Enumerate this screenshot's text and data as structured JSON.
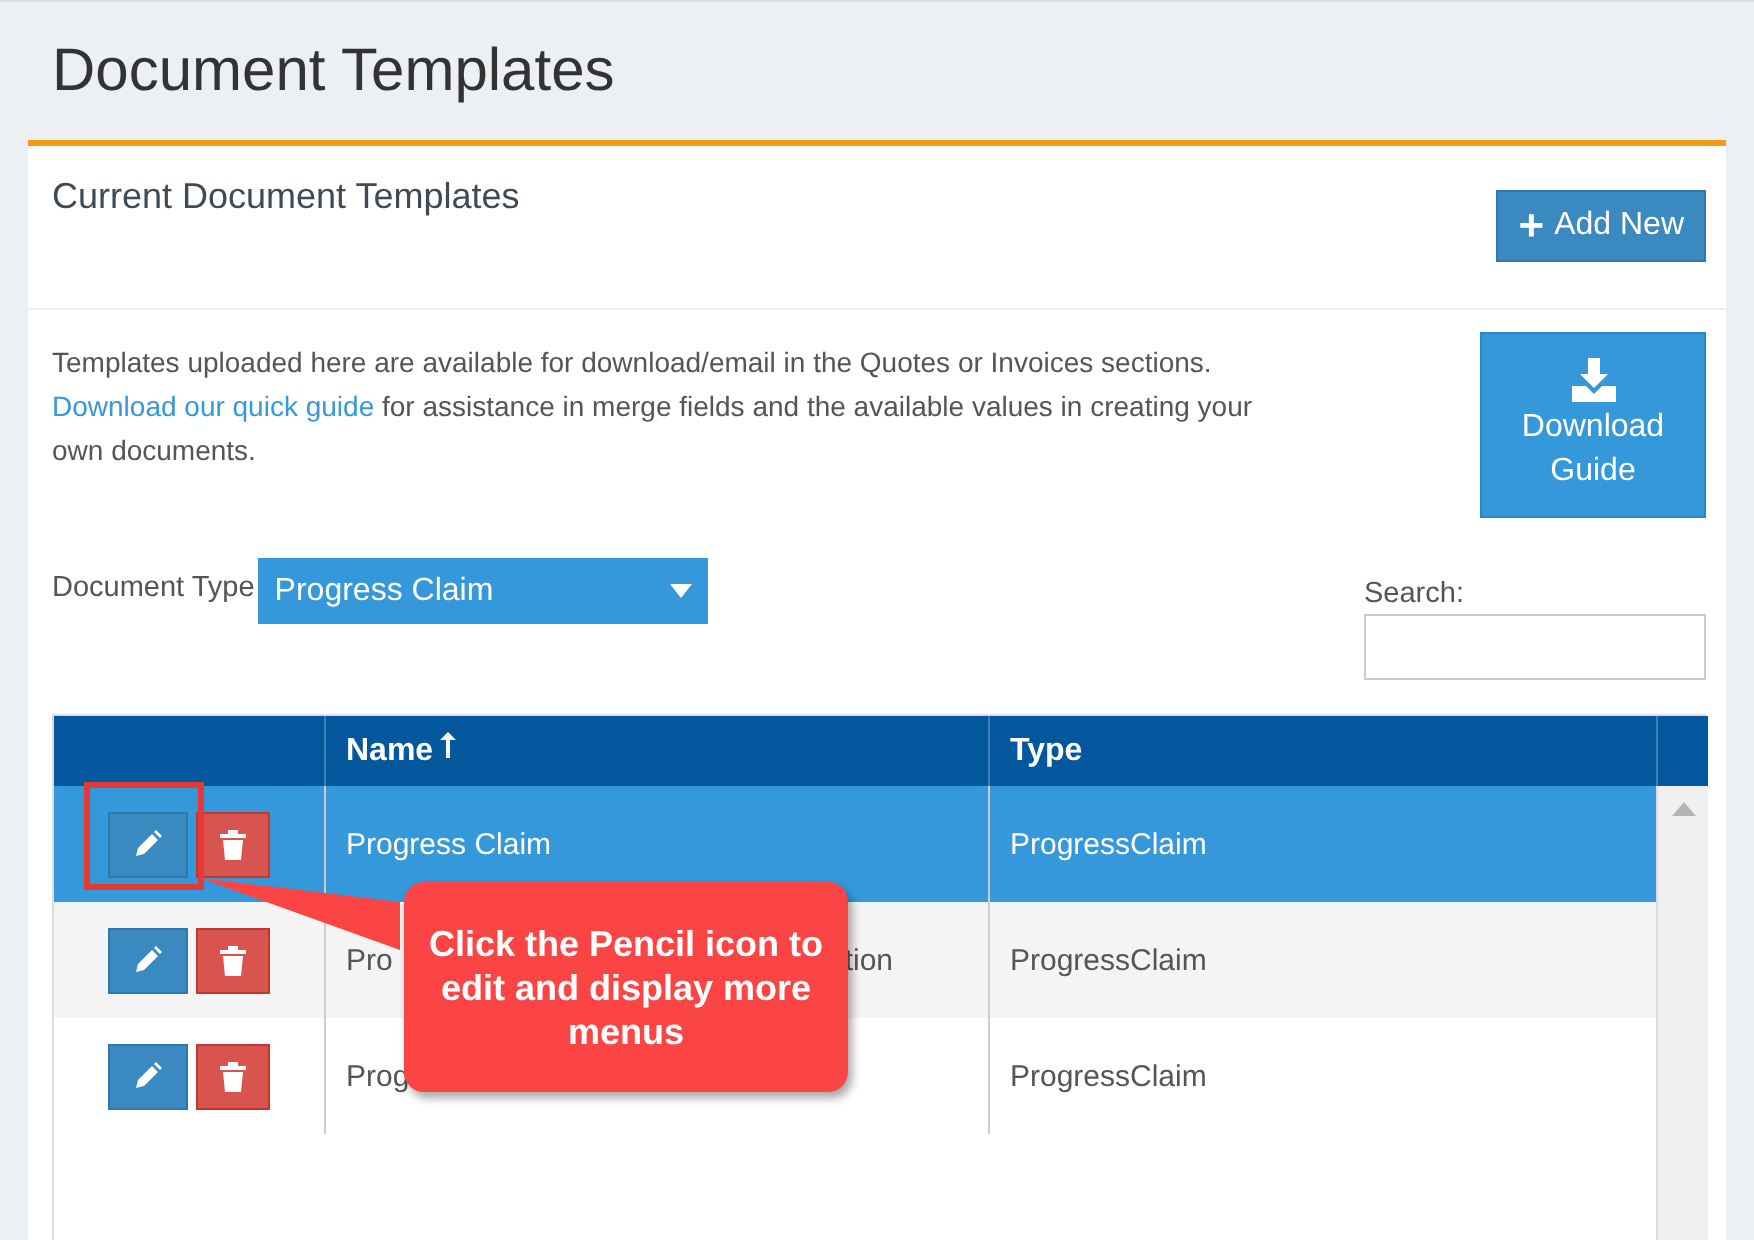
{
  "page_title": "Document Templates",
  "panel": {
    "title": "Current Document Templates",
    "add_button": {
      "icon": "+",
      "label": "Add New"
    }
  },
  "intro": {
    "text": "Templates uploaded here are available for download/email in the Quotes or Invoices sections.",
    "link": "Download our quick guide",
    "text_after": " for assistance in merge fields and the available values in creating your own documents."
  },
  "download_button": {
    "label": "Download Guide"
  },
  "filter": {
    "label": "Document Type",
    "value": "Progress Claim"
  },
  "search": {
    "label": "Search:"
  },
  "table": {
    "columns": [
      {
        "label": "Name",
        "sorted": true
      },
      {
        "label": "Type",
        "sorted": false
      }
    ],
    "rows": [
      {
        "selected": true,
        "highlighted": true,
        "name_parts": [
          "Progress Claim"
        ],
        "type": "ProgressClaim"
      },
      {
        "selected": false,
        "highlighted": false,
        "name_parts": [
          "Pro",
          "tion"
        ],
        "type": "ProgressClaim"
      },
      {
        "selected": false,
        "highlighted": false,
        "name_parts": [
          "Prog"
        ],
        "type": "ProgressClaim"
      }
    ]
  },
  "callout": {
    "text": "Click the Pencil icon to edit and display more menus"
  }
}
